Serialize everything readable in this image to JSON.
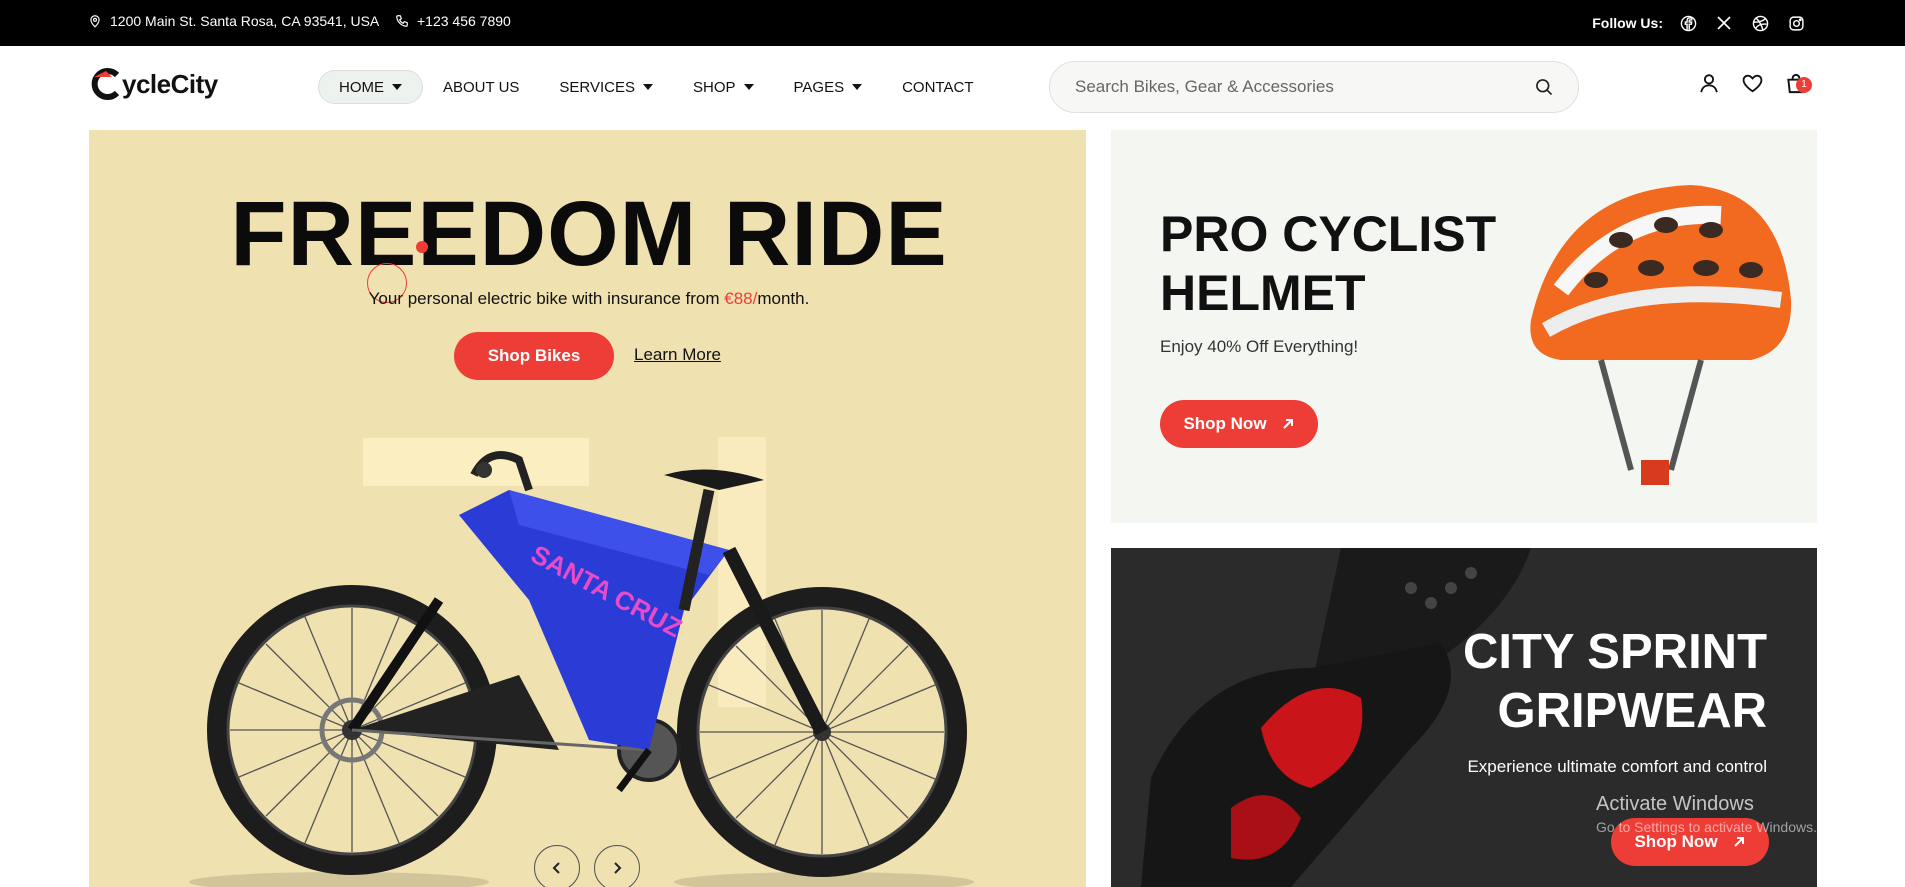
{
  "topbar": {
    "address": "1200 Main St. Santa Rosa, CA 93541, USA",
    "phone": "+123 456 7890",
    "follow_label": "Follow Us:"
  },
  "header": {
    "logo_text": "ycleCity",
    "nav": [
      {
        "label": "HOME"
      },
      {
        "label": "ABOUT US"
      },
      {
        "label": "SERVICES"
      },
      {
        "label": "SHOP"
      },
      {
        "label": "PAGES"
      },
      {
        "label": "CONTACT"
      }
    ],
    "search_placeholder": "Search Bikes, Gear & Accessories",
    "cart_count": "1"
  },
  "hero": {
    "title": "FREEDOM RIDE",
    "subtitle_pre": "Your personal electric bike with insurance from ",
    "subtitle_price": "€88/",
    "subtitle_post": "month.",
    "primary_cta": "Shop Bikes",
    "secondary_cta": "Learn More",
    "bike_brand": "SANTA CRUZ"
  },
  "promo_helmet": {
    "title_line1": "PRO CYCLIST",
    "title_line2": "HELMET",
    "subtitle": "Enjoy 40% Off Everything!",
    "cta": "Shop Now"
  },
  "promo_gloves": {
    "title_line1": "CITY SPRINT",
    "title_line2": "GRIPWEAR",
    "subtitle": "Experience ultimate comfort and control",
    "cta": "Shop Now"
  },
  "os_overlay": {
    "title": "Activate Windows",
    "subtitle": "Go to Settings to activate Windows."
  },
  "colors": {
    "accent": "#ee3d36",
    "hero_bg": "#efe1b0",
    "topbar_bg": "#000000",
    "bike_frame": "#2a3bd6"
  }
}
